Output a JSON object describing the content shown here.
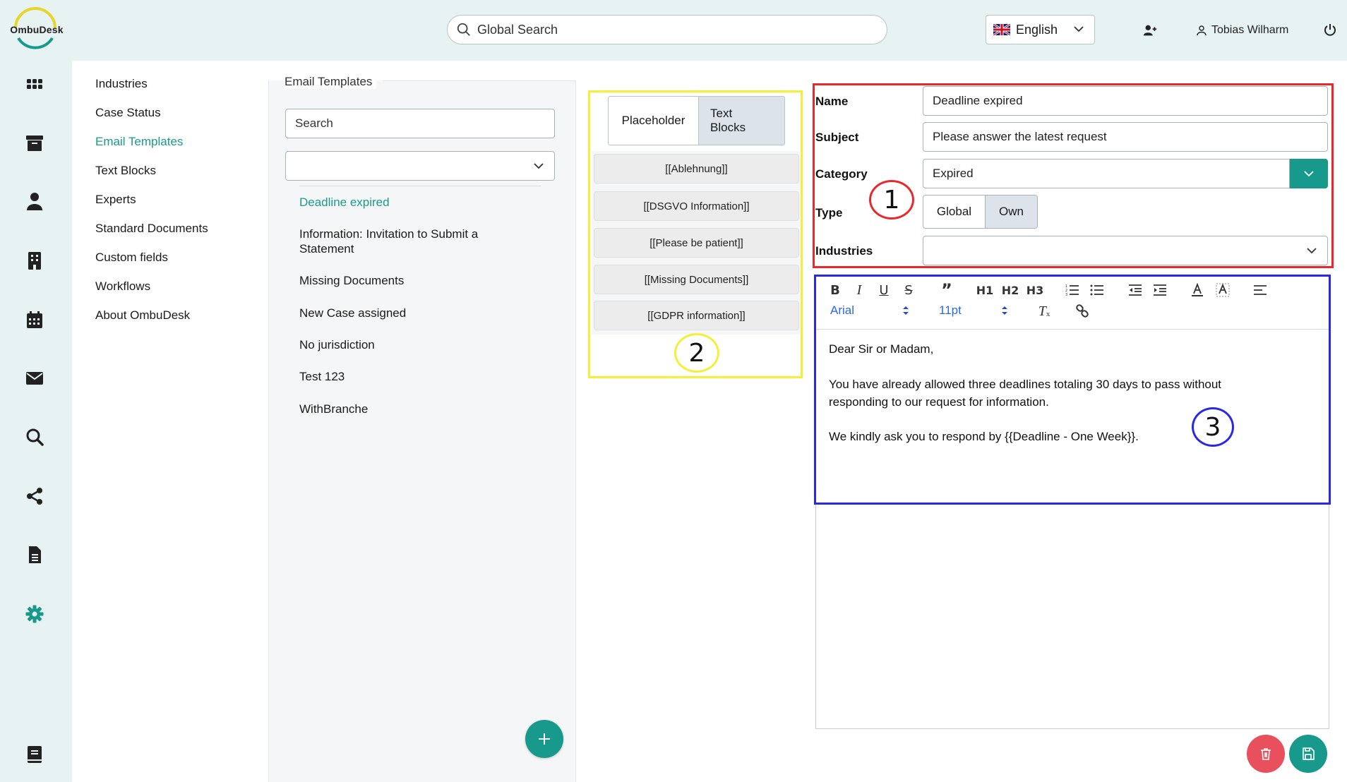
{
  "app": {
    "logo_text": "OmbuDesk",
    "colors": {
      "accent": "#17998b",
      "danger": "#e8505d",
      "rail_bg": "#e7f2f2",
      "annotation_red": "#e8282b",
      "annotation_yellow": "#f4f03a",
      "annotation_blue": "#2828e6"
    }
  },
  "topbar": {
    "search_placeholder": "Global Search",
    "language": "English",
    "user_name": "Tobias Wilharm",
    "icons": [
      "search-icon",
      "uk-flag-icon",
      "chevron-down-icon",
      "add-user-icon",
      "user-icon",
      "power-icon"
    ]
  },
  "rail": {
    "icons": [
      "apps-grid-icon",
      "archive-icon",
      "person-icon",
      "building-icon",
      "calendar-icon",
      "envelope-icon",
      "search-icon",
      "share-icon",
      "document-icon",
      "gear-icon",
      "book-icon"
    ],
    "active": "gear-icon"
  },
  "nav": {
    "items": [
      "Industries",
      "Case Status",
      "Email Templates",
      "Text Blocks",
      "Experts",
      "Standard Documents",
      "Custom fields",
      "Workflows",
      "About OmbuDesk"
    ],
    "active": "Email Templates"
  },
  "templates": {
    "title": "Email Templates",
    "search_placeholder": "Search",
    "filter_value": "",
    "items": [
      "Deadline expired",
      "Information: Invitation to Submit a Statement",
      "Missing Documents",
      "New Case assigned",
      "No jurisdiction",
      "Test 123",
      "WithBranche"
    ],
    "active": "Deadline expired"
  },
  "placeholders": {
    "tab_placeholder": "Placeholder",
    "tab_text_blocks": "Text Blocks",
    "active_tab": "Text Blocks",
    "items": [
      "[[Ablehnung]]",
      "[[DSGVO Information]]",
      "[[Please be patient]]",
      "[[Missing Documents]]",
      "[[GDPR information]]"
    ]
  },
  "form": {
    "labels": {
      "name": "Name",
      "subject": "Subject",
      "category": "Category",
      "type": "Type",
      "industries": "Industries"
    },
    "name": "Deadline expired",
    "subject": "Please answer the latest request",
    "category": "Expired",
    "type_options": [
      "Global",
      "Own"
    ],
    "type_selected": "Own",
    "industries": ""
  },
  "editor": {
    "font": "Arial",
    "size": "11pt",
    "toolbar": [
      "bold-icon",
      "italic-icon",
      "underline-icon",
      "strikethrough-icon",
      "blockquote-icon",
      "heading1-icon",
      "heading2-icon",
      "heading3-icon",
      "ordered-list-icon",
      "bullet-list-icon",
      "outdent-icon",
      "indent-icon",
      "text-color-icon",
      "background-color-icon",
      "align-icon",
      "clear-format-icon",
      "link-icon"
    ],
    "h1": "H1",
    "h2": "H2",
    "h3": "H3",
    "body": [
      "Dear Sir or Madam,",
      "You have already allowed three deadlines totaling 30 days to pass without responding to our request for information.",
      "We kindly ask you to respond by {{Deadline - One Week}}."
    ]
  },
  "annotations": [
    "1",
    "2",
    "3"
  ]
}
